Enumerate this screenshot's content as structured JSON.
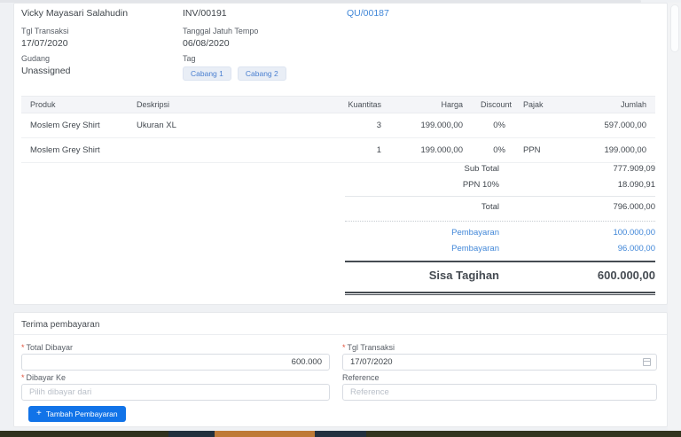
{
  "invoice_panel": {
    "customer_name": "Vicky Mayasari Salahudin",
    "invoice_number": "INV/00191",
    "quotation_link": "QU/00187",
    "fields": {
      "tgl_transaksi": {
        "label": "Tgl Transaksi",
        "value": "17/07/2020"
      },
      "jatuh_tempo": {
        "label": "Tanggal Jatuh Tempo",
        "value": "06/08/2020"
      },
      "gudang": {
        "label": "Gudang",
        "value": "Unassigned"
      },
      "tag": {
        "label": "Tag"
      }
    },
    "tags": [
      "Cabang 1",
      "Cabang 2"
    ],
    "table": {
      "headers": [
        "Produk",
        "Deskripsi",
        "Kuantitas",
        "Harga",
        "Discount",
        "Pajak",
        "Jumlah"
      ],
      "rows": [
        {
          "produk": "Moslem Grey Shirt",
          "deskripsi": "Ukuran XL",
          "kuantitas": "3",
          "harga": "199.000,00",
          "discount": "0%",
          "pajak": "",
          "jumlah": "597.000,00"
        },
        {
          "produk": "Moslem Grey Shirt",
          "deskripsi": "",
          "kuantitas": "1",
          "harga": "199.000,00",
          "discount": "0%",
          "pajak": "PPN",
          "jumlah": "199.000,00"
        }
      ]
    },
    "totals": {
      "sub_total": {
        "label": "Sub Total",
        "value": "777.909,09"
      },
      "tax": {
        "label": "PPN 10%",
        "value": "18.090,91"
      },
      "total": {
        "label": "Total",
        "value": "796.000,00"
      },
      "payments": [
        {
          "label": "Pembayaran",
          "value": "100.000,00"
        },
        {
          "label": "Pembayaran",
          "value": "96.000,00"
        }
      ],
      "balance": {
        "label": "Sisa Tagihan",
        "value": "600.000,00"
      }
    }
  },
  "payment_form": {
    "title": "Terima pembayaran",
    "required_marker": "*",
    "total_dibayar": {
      "label": "Total Dibayar",
      "value": "600.000"
    },
    "tgl_transaksi": {
      "label": "Tgl Transaksi",
      "value": "17/07/2020"
    },
    "dibayar_ke": {
      "label": "Dibayar Ke",
      "placeholder": "Pilih dibayar dari"
    },
    "reference": {
      "label": "Reference",
      "placeholder": "Reference"
    },
    "add_payment_button": "Tambah Pembayaran",
    "plus_icon": "+"
  },
  "colors": {
    "accent_blue": "#4187d8",
    "button_blue": "#1173e8",
    "bar_olive_left": "#30321e",
    "bar_navy": "#22303d",
    "bar_orange": "#bf7a36",
    "bar_navy2": "#233140",
    "bar_olive_right": "#33351f"
  }
}
